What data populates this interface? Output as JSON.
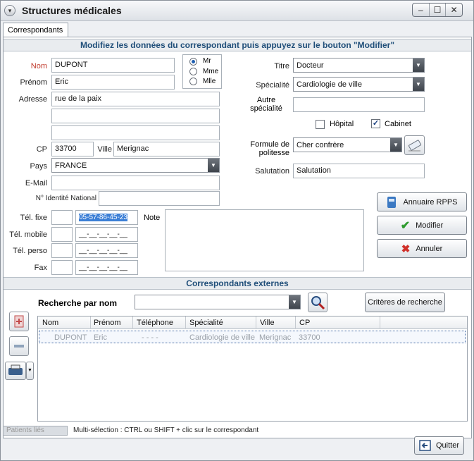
{
  "window": {
    "title": "Structures médicales",
    "sys_glyph": "▾",
    "min": "‒",
    "max": "☐",
    "close": "✕"
  },
  "tabs": [
    {
      "label": "Correspondants"
    }
  ],
  "form": {
    "header": "Modifiez les données du correspondant puis appuyez sur le bouton \"Modifier\"",
    "nom_label": "Nom",
    "nom_value": "DUPONT",
    "prenom_label": "Prénom",
    "prenom_value": "Eric",
    "civilite": {
      "options": [
        "Mr",
        "Mme",
        "Mlle"
      ],
      "selected": "Mr"
    },
    "adresse_label": "Adresse",
    "adresse_1": "rue de la paix",
    "adresse_2": "",
    "adresse_3": "",
    "cp_label": "CP",
    "cp_value": "33700",
    "ville_label": "Ville",
    "ville_value": "Merignac",
    "pays_label": "Pays",
    "pays_value": "FRANCE",
    "email_label": "E-Mail",
    "email_value": "",
    "nin_label": "N° Identité National",
    "nin_value": "",
    "titre_label": "Titre",
    "titre_value": "Docteur",
    "specialite_label": "Spécialité",
    "specialite_value": "Cardiologie de ville",
    "autre_specialite_label_1": "Autre",
    "autre_specialite_label_2": "spécialité",
    "autre_specialite_value": "",
    "hopital_label": "Hôpital",
    "hopital_checked": false,
    "cabinet_label": "Cabinet",
    "cabinet_checked": true,
    "formule_label_1": "Formule de",
    "formule_label_2": "politesse",
    "formule_value": "Cher confrère",
    "salutation_label": "Salutation",
    "salutation_value": "Salutation",
    "tel_fixe_label": "Tél. fixe",
    "tel_fixe_value": "05-57-86-45-23",
    "tel_mobile_label": "Tél. mobile",
    "tel_mobile_value": "__-__-__-__-__",
    "tel_perso_label": "Tél. perso",
    "tel_perso_value": "__-__-__-__-__",
    "fax_label": "Fax",
    "fax_value": "__-__-__-__-__",
    "note_label": "Note",
    "note_value": ""
  },
  "buttons": {
    "annuaire": "Annuaire RPPS",
    "modifier": "Modifier",
    "annuler": "Annuler",
    "criteres": "Critères de recherche",
    "quitter": "Quitter"
  },
  "externes": {
    "header": "Correspondants  externes",
    "recherche_label": "Recherche par nom",
    "recherche_value": "",
    "columns": [
      "Nom",
      "Prénom",
      "Téléphone",
      "Spécialité",
      "Ville",
      "CP"
    ],
    "rows": [
      {
        "nom": "DUPONT",
        "prenom": "Eric",
        "telephone": "- - - -",
        "specialite": "Cardiologie de ville",
        "ville": "Merignac",
        "cp": "33700"
      }
    ]
  },
  "status": {
    "patients_tab": "Patients liés",
    "hint": "Multi-sélection : CTRL ou SHIFT + clic sur le correspondant"
  },
  "colors": {
    "accent": "#1f4e79",
    "required_label": "#c0392b",
    "selection": "#3c7fd6"
  }
}
